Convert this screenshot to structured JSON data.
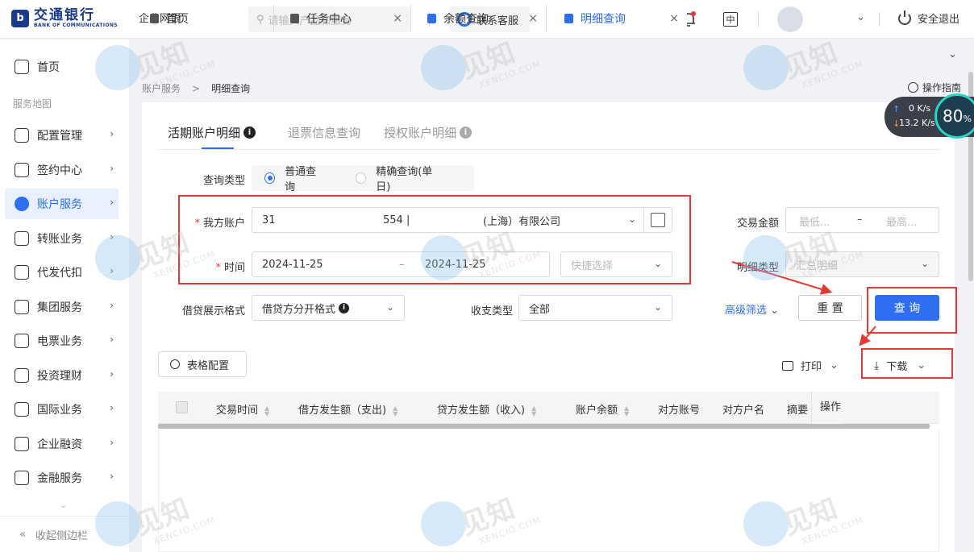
{
  "header": {
    "bank_name_cn": "交通银行",
    "bank_name_en": "BANK OF COMMUNICATIONS",
    "corp_title": "企业网银",
    "search_placeholder": "请输入产品和服务",
    "support_label": "联系客服",
    "language_label": "中",
    "logout_label": "安全退出"
  },
  "sidebar": {
    "home": "首页",
    "section_label": "服务地图",
    "items": [
      {
        "label": "配置管理",
        "icon": "gear-icon"
      },
      {
        "label": "签约中心",
        "icon": "pen-icon"
      },
      {
        "label": "账户服务",
        "icon": "user-icon",
        "active": true
      },
      {
        "label": "转账业务",
        "icon": "transfer-icon"
      },
      {
        "label": "代发代扣",
        "icon": "payroll-icon"
      },
      {
        "label": "集团服务",
        "icon": "group-icon"
      },
      {
        "label": "电票业务",
        "icon": "bill-icon"
      },
      {
        "label": "投资理财",
        "icon": "chart-icon"
      },
      {
        "label": "国际业务",
        "icon": "globe-icon"
      },
      {
        "label": "企业融资",
        "icon": "finance-icon"
      },
      {
        "label": "金融服务",
        "icon": "yen-icon"
      }
    ],
    "collapse_label": "收起侧边栏"
  },
  "tabs": [
    {
      "label": "首页"
    },
    {
      "label": "任务中心"
    },
    {
      "label": "余额查询"
    },
    {
      "label": "明细查询",
      "active": true
    }
  ],
  "breadcrumb": {
    "parent": "账户服务",
    "sep": ">",
    "current": "明细查询"
  },
  "guide_label": "操作指南",
  "subtabs": [
    {
      "label": "活期账户明细",
      "active": true
    },
    {
      "label": "退票信息查询"
    },
    {
      "label": "授权账户明细"
    }
  ],
  "form": {
    "query_type_label": "查询类型",
    "radio_normal": "普通查询",
    "radio_exact": "精确查询(单日)",
    "account_label": "我方账户",
    "account_value_a": "31",
    "account_value_b": "554 |",
    "account_value_c": "(上海）有限公司",
    "time_label": "时间",
    "date_from": "2024-11-25",
    "date_sep": "–",
    "date_to": "2024-11-25",
    "quick_select_placeholder": "快捷选择",
    "amount_label": "交易金额",
    "amount_min_placeholder": "最低...",
    "amount_sep": "–",
    "amount_max_placeholder": "最高...",
    "detail_type_label": "明细类型",
    "detail_type_value": "汇总明细",
    "debit_format_label": "借贷展示格式",
    "debit_format_value": "借贷方分开格式",
    "inout_label": "收支类型",
    "inout_value": "全部",
    "advanced_label": "高级筛选",
    "reset_label": "重 置",
    "query_label": "查 询"
  },
  "toolbar": {
    "table_config": "表格配置",
    "print": "打印",
    "download": "下载"
  },
  "table": {
    "columns": [
      "交易时间",
      "借方发生额（支出)",
      "贷方发生额（收入)",
      "账户余额",
      "对方账号",
      "对方户名",
      "摘要",
      "操作"
    ]
  },
  "netwidget": {
    "up": "0 K/s",
    "down": "13.2 K/s",
    "percent": "80",
    "unit": "%"
  },
  "watermark": {
    "main": "见知",
    "sub": "XENCIO.COM"
  }
}
